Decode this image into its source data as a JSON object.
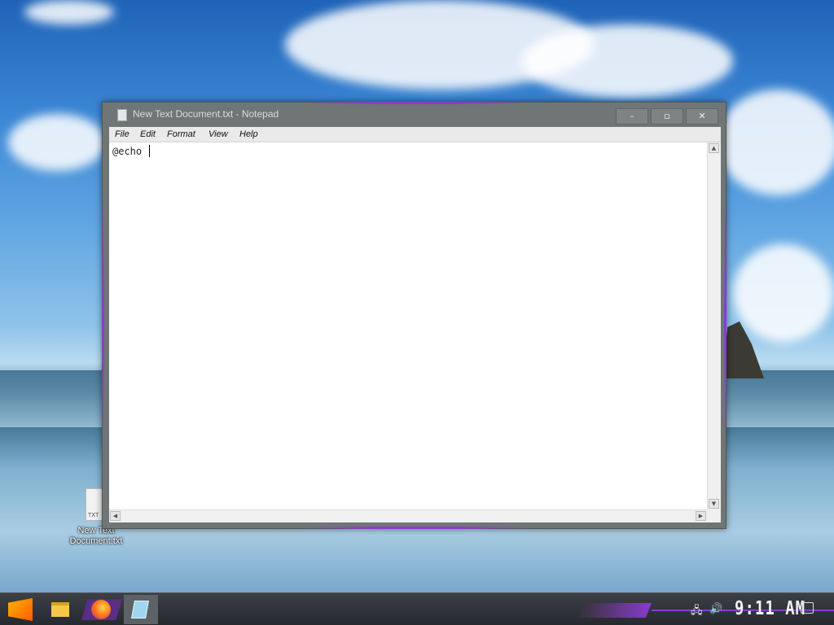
{
  "window": {
    "title": "New Text Document.txt - Notepad",
    "minimize_glyph": "–",
    "maximize_glyph": "▫",
    "close_glyph": "✕"
  },
  "menu": {
    "file": "File",
    "edit": "Edit",
    "format": "Format",
    "view": "View",
    "help": "Help"
  },
  "editor": {
    "content": "@echo "
  },
  "scroll": {
    "up": "▲",
    "down": "▼",
    "left": "◀",
    "right": "▶"
  },
  "desktop": {
    "icon_label_line1": "New Text",
    "icon_label_line2": "Document.txt",
    "icon_badge": "TXT"
  },
  "taskbar": {
    "clock": "9:11 AM",
    "network_glyph": "🖧",
    "volume_glyph": "🔊"
  },
  "colors": {
    "accent": "#8a3bd0",
    "window_frame": "#6f7675"
  }
}
